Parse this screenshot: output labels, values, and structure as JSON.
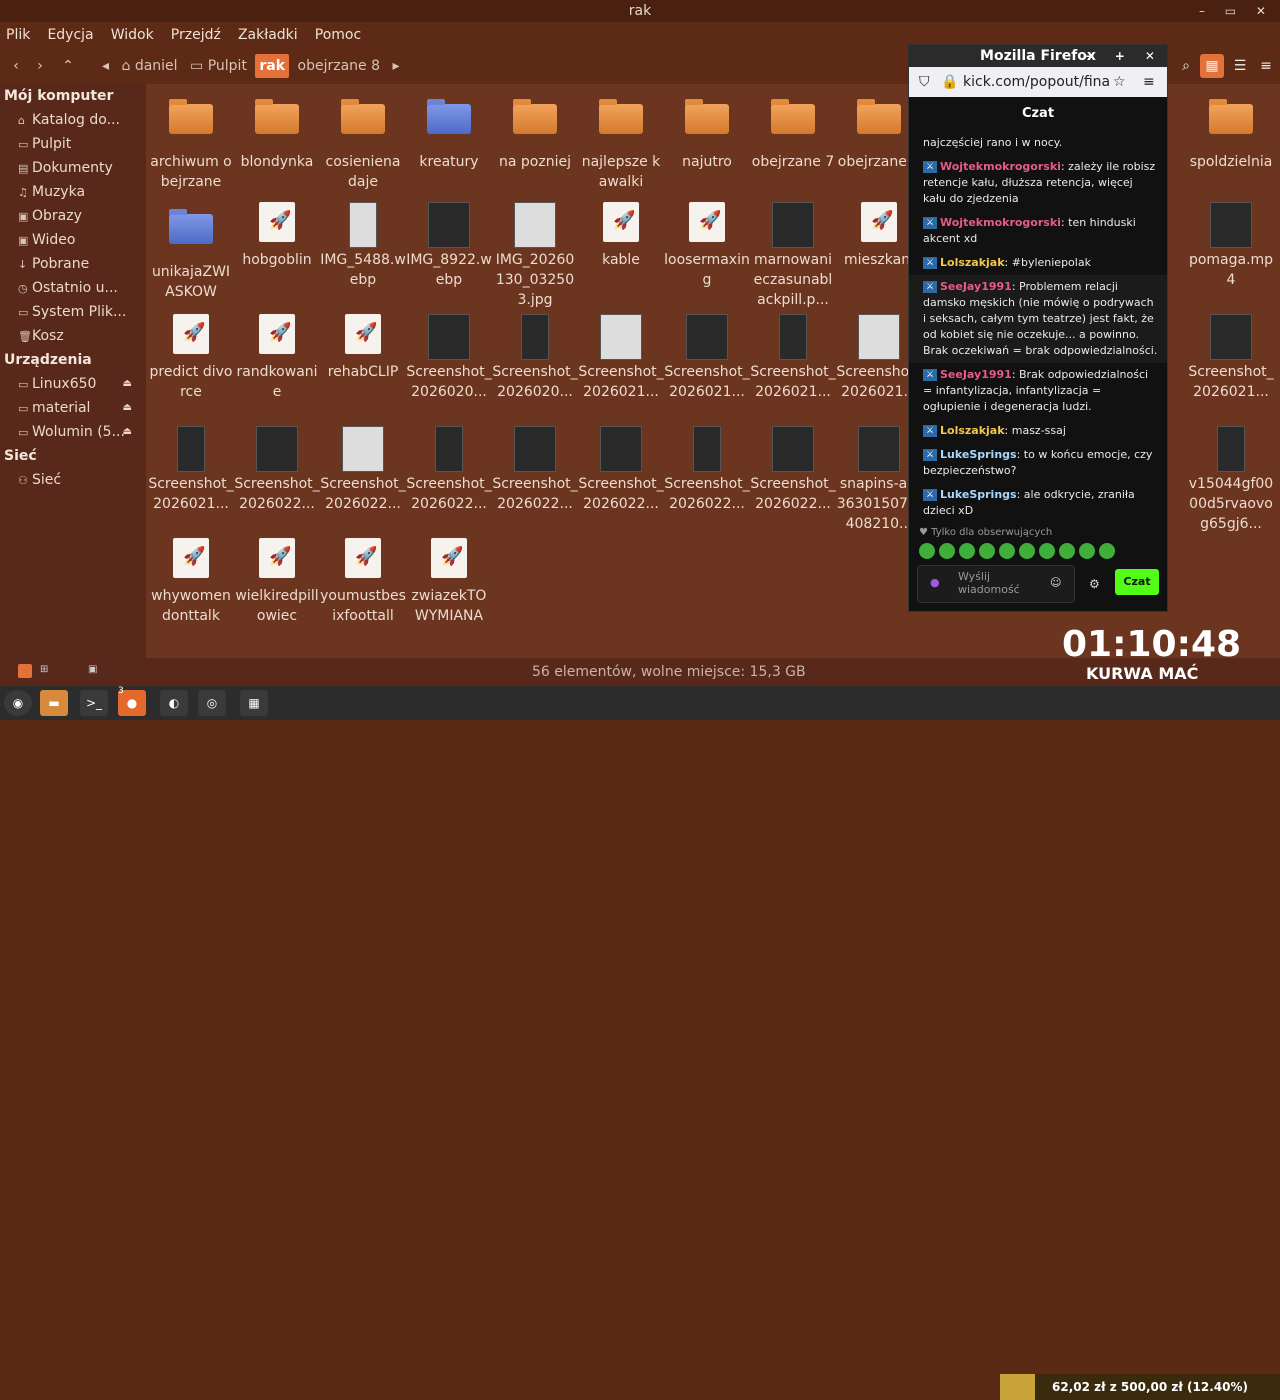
{
  "window": {
    "title": "rak"
  },
  "menu": [
    "Plik",
    "Edycja",
    "Widok",
    "Przejdź",
    "Zakładki",
    "Pomoc"
  ],
  "breadcrumbs": [
    "daniel",
    "Pulpit",
    "rak",
    "obejrzane 8"
  ],
  "sidebar": {
    "sections": [
      {
        "label": "Mój komputer",
        "items": [
          {
            "label": "Katalog do...",
            "icon": "home-icon"
          },
          {
            "label": "Pulpit",
            "icon": "desktop-icon"
          },
          {
            "label": "Dokumenty",
            "icon": "documents-icon"
          },
          {
            "label": "Muzyka",
            "icon": "music-icon"
          },
          {
            "label": "Obrazy",
            "icon": "pictures-icon"
          },
          {
            "label": "Wideo",
            "icon": "video-icon"
          },
          {
            "label": "Pobrane",
            "icon": "download-icon"
          },
          {
            "label": "Ostatnio u...",
            "icon": "recent-icon"
          },
          {
            "label": "System Plik...",
            "icon": "filesystem-icon"
          },
          {
            "label": "Kosz",
            "icon": "trash-icon"
          }
        ]
      },
      {
        "label": "Urządzenia",
        "items": [
          {
            "label": "Linux650",
            "icon": "drive-icon"
          },
          {
            "label": "material",
            "icon": "drive-icon"
          },
          {
            "label": "Wolumin (5...",
            "icon": "drive-icon"
          }
        ]
      },
      {
        "label": "Sieć",
        "items": [
          {
            "label": "Sieć",
            "icon": "network-icon"
          }
        ]
      }
    ]
  },
  "files": [
    {
      "label": "archiwum obejrzane",
      "type": "folder"
    },
    {
      "label": "blondynka",
      "type": "folder"
    },
    {
      "label": "cosieniena daje",
      "type": "folder"
    },
    {
      "label": "kreatury",
      "type": "folder-blue"
    },
    {
      "label": "na pozniej",
      "type": "folder"
    },
    {
      "label": "najlepsze kawalki",
      "type": "folder"
    },
    {
      "label": "najutro",
      "type": "folder"
    },
    {
      "label": "obejrzane 7",
      "type": "folder"
    },
    {
      "label": "obejrzane 8",
      "type": "folder"
    },
    {
      "label": "spoldzielnia",
      "type": "folder"
    },
    {
      "label": "unikajaZWIASKOW",
      "type": "folder-blue"
    },
    {
      "label": "hobgoblin",
      "type": "doc"
    },
    {
      "label": "IMG_5488.webp",
      "type": "thumb-light"
    },
    {
      "label": "IMG_8922.webp",
      "type": "thumb"
    },
    {
      "label": "IMG_20260130_032503.jpg",
      "type": "thumb-light"
    },
    {
      "label": "kable",
      "type": "doc"
    },
    {
      "label": "loosermaxing",
      "type": "doc"
    },
    {
      "label": "marnowanieczasunablackpill.p...",
      "type": "thumb"
    },
    {
      "label": "mieszkani",
      "type": "doc"
    },
    {
      "label": "pomaga.mp4",
      "type": "thumb"
    },
    {
      "label": "predict divorce",
      "type": "doc"
    },
    {
      "label": "randkowanie",
      "type": "doc"
    },
    {
      "label": "rehabCLIP",
      "type": "doc"
    },
    {
      "label": "Screenshot_2026020...",
      "type": "thumb"
    },
    {
      "label": "Screenshot_2026020...",
      "type": "thumb"
    },
    {
      "label": "Screenshot_2026021...",
      "type": "thumb-light"
    },
    {
      "label": "Screenshot_2026021...",
      "type": "thumb"
    },
    {
      "label": "Screenshot_2026021...",
      "type": "thumb"
    },
    {
      "label": "Screenshot_2026021...",
      "type": "thumb-light"
    },
    {
      "label": "Screenshot_2026021...",
      "type": "thumb"
    },
    {
      "label": "Screenshot_2026021...",
      "type": "thumb"
    },
    {
      "label": "Screenshot_2026022...",
      "type": "thumb"
    },
    {
      "label": "Screenshot_2026022...",
      "type": "thumb-light"
    },
    {
      "label": "Screenshot_2026022...",
      "type": "thumb"
    },
    {
      "label": "Screenshot_2026022...",
      "type": "thumb"
    },
    {
      "label": "Screenshot_2026022...",
      "type": "thumb"
    },
    {
      "label": "Screenshot_2026022...",
      "type": "thumb"
    },
    {
      "label": "Screenshot_2026022...",
      "type": "thumb"
    },
    {
      "label": "snapins-ai_36301507 7408210...",
      "type": "thumb"
    },
    {
      "label": "v15044gf0000d5rvaovog65gj6...",
      "type": "thumb"
    },
    {
      "label": "whywomendonttalk",
      "type": "doc"
    },
    {
      "label": "wielkiredpillowiec",
      "type": "doc"
    },
    {
      "label": "youmustbesixfoottall",
      "type": "doc"
    },
    {
      "label": "zwiazekTOWYMIANA",
      "type": "doc"
    }
  ],
  "status": "56 elementów, wolne miejsce: 15,3 GB",
  "firefox": {
    "title": "Mozilla Firefox",
    "url": "kick.com/popout/fina",
    "chat_header": "Czat",
    "messages": [
      {
        "user": "",
        "text": "najczęściej rano i w nocy."
      },
      {
        "user": "Wojtekmokrogorski",
        "text": ": zależy ile robisz retencje kału, dłuższa retencja, więcej kału do zjedzenia",
        "color": "#e85a8a"
      },
      {
        "user": "Wojtekmokrogorski",
        "text": ": ten hinduski akcent xd",
        "color": "#e85a8a"
      },
      {
        "user": "Lolszakjak",
        "text": ": #byleniepolak",
        "color": "#f2c94c"
      },
      {
        "user": "SeeJay1991",
        "text": ": Problemem relacji damsko męskich (nie mówię o podrywach i seksach, całym tym teatrze) jest fakt, że od kobiet się nie oczekuje... a powinno. Brak oczekiwań = brak odpowiedzialności.",
        "color": "#e85a8a"
      },
      {
        "user": "SeeJay1991",
        "text": ": Brak odpowiedzialności = infantylizacja, infantylizacja = ogłupienie i degeneracja ludzi.",
        "color": "#e85a8a"
      },
      {
        "user": "Lolszakjak",
        "text": ": masz-ssaj",
        "color": "#f2c94c"
      },
      {
        "user": "LukeSprings",
        "text": ": to w końcu emocje, czy bezpieczeństwo?",
        "color": "#a8d8ff"
      },
      {
        "user": "LukeSprings",
        "text": ": ale odkrycie, zraniła dzieci xD",
        "color": "#a8d8ff"
      }
    ],
    "followers_only": "Tylko dla obserwujących",
    "input_placeholder": "Wyślij wiadomość",
    "send_label": "Czat"
  },
  "overlay": {
    "timer": "01:10:48",
    "caption": "KURWA MAĆ",
    "donation": "62,02 zł z 500,00 zł (12.40%)",
    "donation_progress": 0.124
  },
  "taskbar": {
    "badge": "3"
  }
}
